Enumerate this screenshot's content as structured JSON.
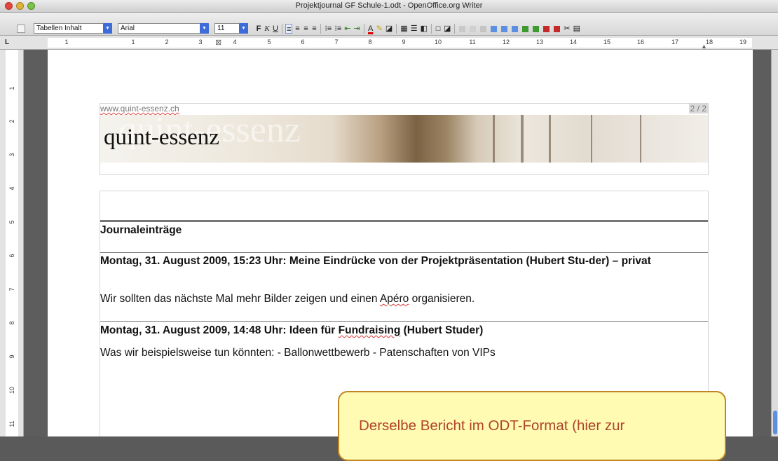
{
  "window": {
    "title": "Projektjournal GF Schule-1.odt - OpenOffice.org Writer"
  },
  "toolbar": {
    "paragraph_style": "Tabellen Inhalt",
    "font_name": "Arial",
    "font_size": "11",
    "bold_label": "F",
    "italic_label": "K",
    "underline_label": "U"
  },
  "ruler": {
    "corner": "L",
    "marks": [
      "1",
      "1",
      "2",
      "3",
      "4",
      "5",
      "6",
      "7",
      "8",
      "9",
      "10",
      "11",
      "12",
      "13",
      "14",
      "15",
      "16",
      "17",
      "18",
      "19"
    ],
    "vmarks": [
      "1",
      "2",
      "3",
      "4",
      "5",
      "6",
      "7",
      "8",
      "9",
      "10",
      "11"
    ]
  },
  "document": {
    "header_url": "www.quint-essenz.ch",
    "page_count": "2 / 2",
    "logo_text": "quint-essenz",
    "logo_ghost": "quint-essenz",
    "section_title": "Journaleinträge",
    "entries": [
      {
        "title": "Montag, 31. August 2009, 15:23 Uhr: Meine Eindrücke von der Projektpräsentation (Hubert Stu-der) – privat",
        "text_before": "Wir sollten das nächste Mal mehr Bilder zeigen und einen ",
        "text_marked": "Apéro",
        "text_after": " organisieren."
      },
      {
        "title_before": "Montag, 31. August 2009, 14:48 Uhr: Ideen für ",
        "title_marked": "Fundraising",
        "title_after": " (Hubert Studer)",
        "text": "Was wir beispielsweise tun könnten: - Ballonwettbewerb - Patenschaften von VIPs"
      }
    ]
  },
  "callout": {
    "text": "Derselbe Bericht im ODT-Format (hier zur"
  },
  "colors": {
    "accent": "#3d6bd8",
    "callout_bg": "#fffbb3",
    "callout_border": "#c18522",
    "callout_text": "#b0432b"
  }
}
